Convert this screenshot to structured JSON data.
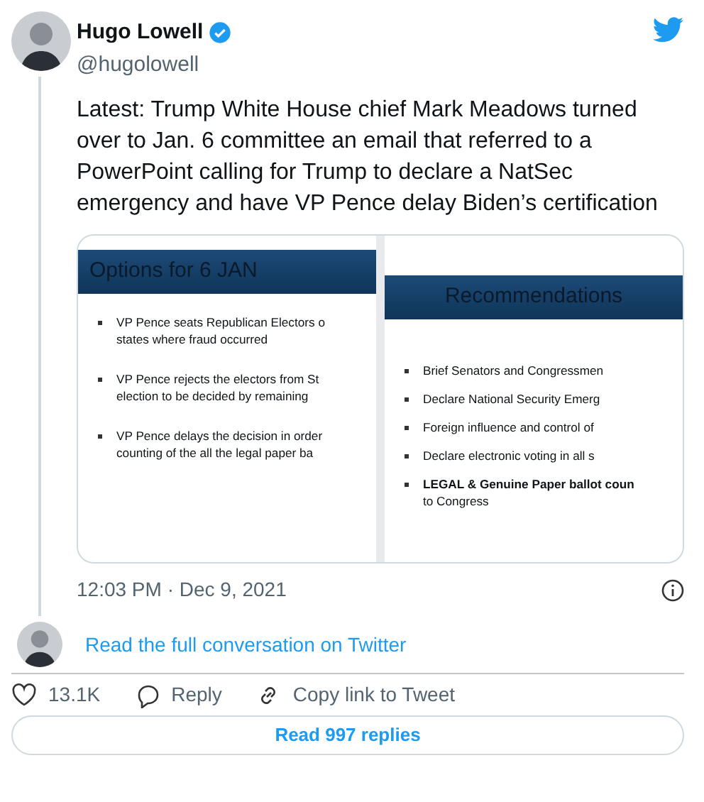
{
  "author": {
    "name": "Hugo Lowell",
    "handle": "@hugolowell",
    "verified": true
  },
  "text": "Latest: Trump White House chief Mark Meadows turned over to Jan. 6 committee an email that referred to a PowerPoint calling for Trump to declare a NatSec emergency and have VP Pence delay Biden’s certification",
  "slides": [
    {
      "title": "Options for 6 JAN",
      "kind": "agenda",
      "bullets": [
        [
          "VP Pence seats Republican Electors o",
          "states where fraud occurred"
        ],
        [
          "VP Pence rejects the electors from St",
          "election to be decided by remaining"
        ],
        [
          "VP Pence delays the decision in order",
          "counting of the all the legal paper ba"
        ]
      ]
    },
    {
      "title": "Recommendations",
      "kind": "summary",
      "bullets": [
        [
          "Brief Senators and Congressmen"
        ],
        [
          "Declare National Security Emerg"
        ],
        [
          "Foreign influence and control of"
        ],
        [
          "Declare electronic voting in all s"
        ],
        [
          "**LEGAL & Genuine Paper ballot coun**",
          "to Congress"
        ]
      ]
    }
  ],
  "timestamp": "12:03 PM · Dec 9, 2021",
  "conversation_link": "Read the full conversation on Twitter",
  "actions": [
    {
      "kind": "like",
      "label": "13.1K"
    },
    {
      "kind": "reply",
      "label": "Reply"
    },
    {
      "kind": "copy",
      "label": "Copy link to Tweet"
    }
  ],
  "replies_button": "Read 997 replies"
}
